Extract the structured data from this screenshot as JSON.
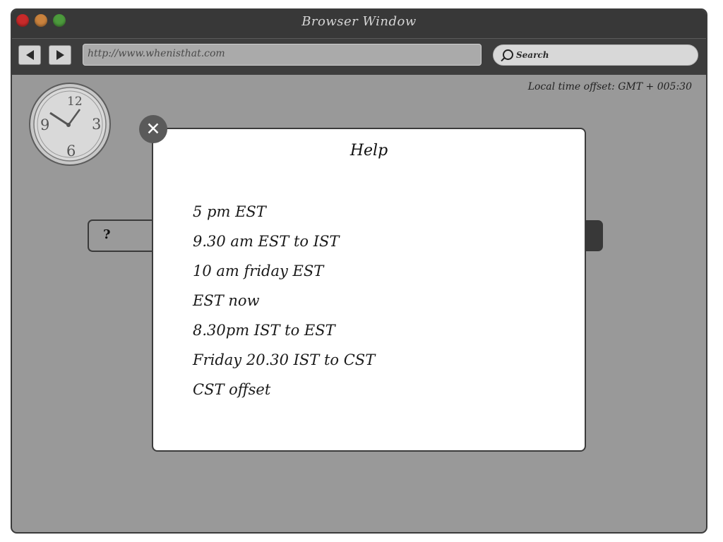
{
  "window": {
    "title": "Browser Window"
  },
  "toolbar": {
    "back_icon": "back-arrow-icon",
    "forward_icon": "forward-arrow-icon",
    "url": "http://www.whenisthat.com",
    "search_label": "Search"
  },
  "page": {
    "local_offset": "Local time offset: GMT + 005:30",
    "query_value": "?"
  },
  "help_modal": {
    "title": "Help",
    "examples": [
      "5 pm EST",
      "9.30 am EST to IST",
      "10 am friday EST",
      "EST now",
      "8.30pm IST to EST",
      "Friday 20.30 IST to CST",
      "CST offset"
    ],
    "close_icon": "close-icon"
  },
  "colors": {
    "title_bar": "#383838",
    "page_overlay": "#999999",
    "close_light": "#c82a2a",
    "minimize_light": "#c9823d",
    "maximize_light": "#4c9a3c"
  }
}
